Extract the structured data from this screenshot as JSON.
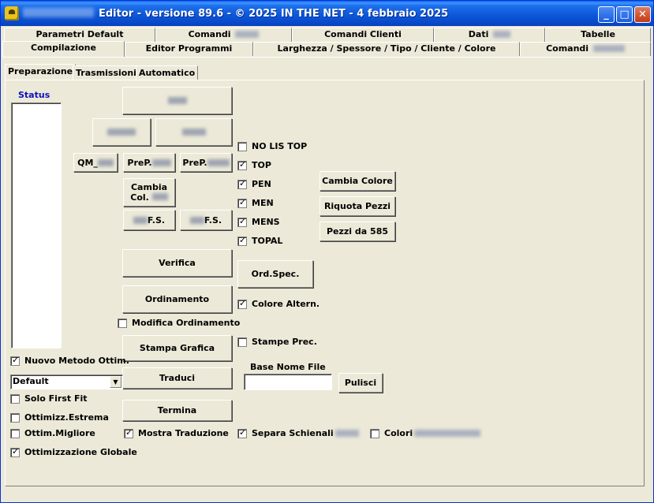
{
  "window": {
    "title": "Editor - versione 89.6 - © 2025  IN THE NET - 4 febbraio 2025",
    "minimize": "_",
    "maximize": "□",
    "close": "✕"
  },
  "tabs_row1": [
    {
      "label": "Parametri Default"
    },
    {
      "label": "Comandi "
    },
    {
      "label": "Comandi Clienti"
    },
    {
      "label": "Dati "
    },
    {
      "label": "Tabelle"
    }
  ],
  "tabs_row2": [
    {
      "label": "Compilazione"
    },
    {
      "label": "Editor Programmi"
    },
    {
      "label": "Larghezza / Spessore / Tipo / Cliente / Colore"
    },
    {
      "label": "Comandi "
    }
  ],
  "subtabs": [
    {
      "label": "Preparazione"
    },
    {
      "label": "Trasmissioni"
    },
    {
      "label": "Automatico"
    }
  ],
  "status_label": "Status",
  "buttons": {
    "ala": "",
    "febal": "",
    "ateo": "",
    "qm": "QM_",
    "prep1": "PreP.",
    "prep2": "PreP.",
    "cambia_col_l1": "Cambia",
    "cambia_col_l2": "Col. ",
    "fs1": " F.S.",
    "fs2": " F.S.",
    "verifica": "Verifica",
    "ordinamento": "Ordinamento",
    "stampa_grafica": "Stampa Grafica",
    "traduci": "Traduci",
    "termina": "Termina",
    "ord_spec": "Ord.Spec.",
    "cambia_colore": "Cambia Colore",
    "riquota_pezzi": "Riquota Pezzi",
    "pezzi_585": "Pezzi da 585",
    "pulisci": "Pulisci"
  },
  "checkboxes": {
    "no_lis_top": {
      "label": "NO LIS TOP",
      "checked": false
    },
    "top": {
      "label": "TOP",
      "checked": true
    },
    "pen": {
      "label": "PEN",
      "checked": true
    },
    "men": {
      "label": "MEN",
      "checked": true
    },
    "mens": {
      "label": "MENS",
      "checked": true
    },
    "topal": {
      "label": "TOPAL",
      "checked": true
    },
    "colore_altern": {
      "label": "Colore Altern.",
      "checked": true
    },
    "modifica_ordinamento": {
      "label": "Modifica Ordinamento",
      "checked": false
    },
    "stampe_prec": {
      "label": "Stampe Prec.",
      "checked": false
    },
    "nuovo_metodo": {
      "label": "Nuovo Metodo Ottim.",
      "checked": true
    },
    "solo_first_fit": {
      "label": "Solo First Fit",
      "checked": false
    },
    "ottimizz_estrema": {
      "label": "Ottimizz.Estrema",
      "checked": false
    },
    "ottim_migliore": {
      "label": "Ottim.Migliore",
      "checked": false
    },
    "ottimizzazione_globale": {
      "label": "Ottimizzazione Globale",
      "checked": true
    },
    "mostra_traduzione": {
      "label": "Mostra Traduzione",
      "checked": true
    },
    "separa_schienali": {
      "label": "Separa Schienali ",
      "checked": true
    },
    "colori": {
      "label": "Colori ",
      "checked": false
    }
  },
  "base_nome_file": {
    "label": "Base Nome File",
    "value": ""
  },
  "method_select": {
    "value": "Default"
  }
}
